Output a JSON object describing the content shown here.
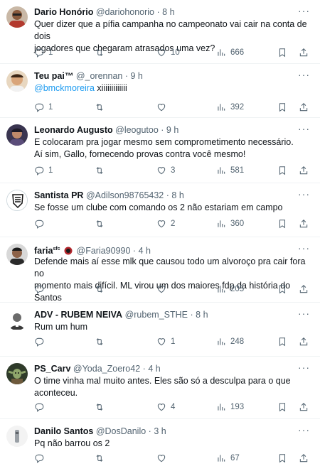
{
  "tweets": [
    {
      "name": "Dario Honório",
      "handle": "@dariohonorio",
      "time": "8 h",
      "text_lines": [
        "Quer dizer que a pífia campanha no campeonato vai cair na conta de dois",
        "jogadores que chegaram atrasados uma vez?"
      ],
      "replies": "1",
      "retweets": "",
      "likes": "10",
      "views": "666"
    },
    {
      "name": "Teu pai™",
      "handle": "@_orennan",
      "time": "9 h",
      "mention": "@bmckmoreira",
      "text_after_mention": " xiiiiiiiiiiiii",
      "replies": "1",
      "retweets": "",
      "likes": "",
      "views": "392"
    },
    {
      "name": "Leonardo Augusto",
      "handle": "@leogutoo",
      "time": "9 h",
      "text_lines": [
        "E colocaram pra jogar mesmo sem comprometimento necessário.",
        "Aí sim, Gallo, fornecendo provas contra você mesmo!"
      ],
      "replies": "1",
      "retweets": "",
      "likes": "3",
      "views": "581"
    },
    {
      "name": "Santista PR",
      "handle": "@Adilson98765432",
      "time": "8 h",
      "text_lines": [
        "Se fosse um clube com comando os 2 não estariam em campo"
      ],
      "replies": "",
      "retweets": "",
      "likes": "2",
      "views": "360"
    },
    {
      "name": "faria",
      "name_suffix": "sfc",
      "handle": "@Faria90990",
      "time": "4 h",
      "text_lines": [
        "Defende mais aí esse mlk que causou todo um alvoroço pra cair fora no",
        "momento mais difícil. ML virou um dos maiores fdp da história do Santos"
      ],
      "replies": "",
      "retweets": "",
      "likes": "",
      "views": "205"
    },
    {
      "name": "ADV - RUBEM NEIVA",
      "handle": "@rubem_STHE",
      "time": "8 h",
      "text_lines": [
        "Rum um hum"
      ],
      "replies": "",
      "retweets": "",
      "likes": "1",
      "views": "248"
    },
    {
      "name": "PS_Carv",
      "handle": "@Yoda_Zoero42",
      "time": "4 h",
      "text_lines": [
        "O time vinha mal muito antes. Eles são só a desculpa para o que",
        "aconteceu."
      ],
      "replies": "",
      "retweets": "",
      "likes": "4",
      "views": "193"
    },
    {
      "name": "Danilo Santos",
      "handle": "@DosDanilo",
      "time": "3 h",
      "text_lines": [
        "Pq não barrou os 2"
      ],
      "replies": "",
      "retweets": "",
      "likes": "",
      "views": "67"
    }
  ],
  "separator": "·",
  "more_glyph": "···",
  "colors": {
    "text": "#0f1419",
    "secondary": "#536471",
    "link": "#1d9bf0",
    "divider": "#eff3f4"
  },
  "icons": [
    "reply-icon",
    "retweet-icon",
    "like-icon",
    "views-icon",
    "bookmark-icon",
    "share-icon",
    "more-icon"
  ]
}
